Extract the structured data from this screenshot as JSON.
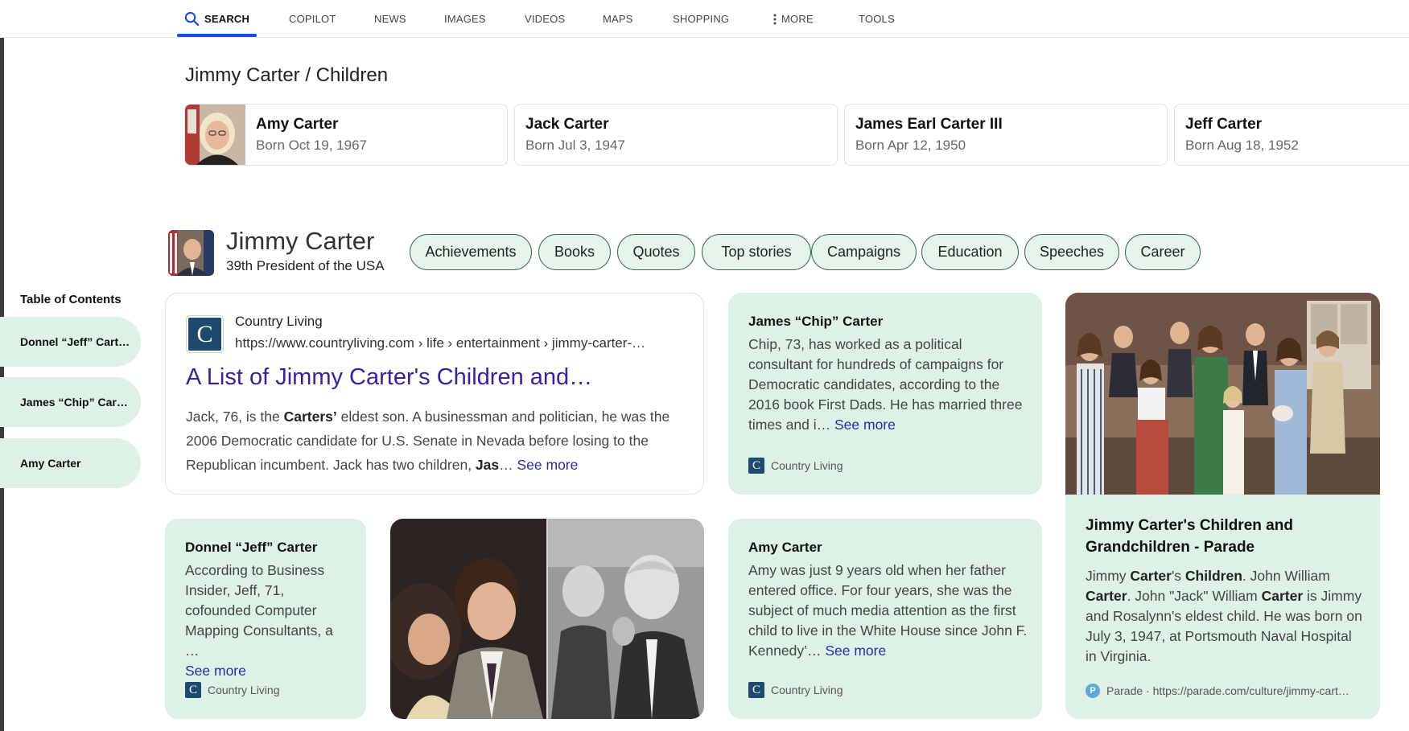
{
  "nav": {
    "search": "SEARCH",
    "copilot": "COPILOT",
    "news": "NEWS",
    "images": "IMAGES",
    "videos": "VIDEOS",
    "maps": "MAPS",
    "shopping": "SHOPPING",
    "more": "MORE",
    "tools": "TOOLS"
  },
  "knowledge_title": "Jimmy Carter / Children",
  "children": [
    {
      "name": "Amy Carter",
      "born": "Born Oct 19, 1967"
    },
    {
      "name": "Jack Carter",
      "born": "Born Jul 3, 1947"
    },
    {
      "name": "James Earl Carter III",
      "born": "Born Apr 12, 1950"
    },
    {
      "name": "Jeff Carter",
      "born": "Born Aug 18, 1952"
    }
  ],
  "entity": {
    "name": "Jimmy Carter",
    "subtitle": "39th President of the USA",
    "chips": [
      "Achievements",
      "Books",
      "Quotes",
      "Top stories",
      "Campaigns",
      "Education",
      "Speeches",
      "Career"
    ]
  },
  "toc": {
    "heading": "Table of Contents",
    "items": [
      "Donnel “Jeff” Cart…",
      "James “Chip” Car…",
      "Amy Carter"
    ]
  },
  "main_result": {
    "source_letter": "C",
    "source": "Country Living",
    "url": "https://www.countryliving.com › life › entertainment › jimmy-carter-…",
    "title": "A List of Jimmy Carter's Children and…",
    "snippet_a": "Jack, 76, is the ",
    "snippet_bold_a": "Carters’",
    "snippet_b": " eldest son. A businessman and politician, he was the 2006 Democratic candidate for U.S. Senate in Nevada before losing to the Republican incumbent. Jack has two children, ",
    "snippet_bold_b": "Jas",
    "snippet_c": "…",
    "see_more": "See more"
  },
  "cards": {
    "chip": {
      "title": "James “Chip” Carter",
      "text": "Chip, 73, has worked as a political consultant for hundreds of campaigns for Democratic candidates, according to the 2016 book First Dads. He has married three times and i…",
      "see_more": "See more",
      "source": "Country Living"
    },
    "jeff": {
      "title": "Donnel “Jeff” Carter",
      "text": "According to Business Insider, Jeff, 71, cofounded Computer Mapping Consultants, a …",
      "see_more": "See more",
      "source": "Country Living"
    },
    "amy": {
      "title": "Amy Carter",
      "text": "Amy was just 9 years old when her father entered office. For four years, she was the subject of much media attention as the first child to live in the White House since John F. Kennedy’…",
      "see_more": "See more",
      "source": "Country Living"
    },
    "parade": {
      "title": "Jimmy Carter's Children and Grandchildren - Parade",
      "t1": "Jimmy ",
      "b1": "Carter",
      "t2": "'s ",
      "b2": "Children",
      "t3": ". John William ",
      "b3": "Carter",
      "t4": ". John \"Jack\" William ",
      "b4": "Carter",
      "t5": " is Jimmy and Rosalynn's eldest child. He was born on July 3, 1947, at Portsmouth Naval Hospital in Virginia.",
      "source": "Parade · https://parade.com/culture/jimmy-cart…"
    }
  },
  "colors": {
    "accent": "#174ae4",
    "card_green": "#ddf1e7",
    "chip_border": "#2f6b48",
    "link_purple": "#3b1fa3"
  }
}
